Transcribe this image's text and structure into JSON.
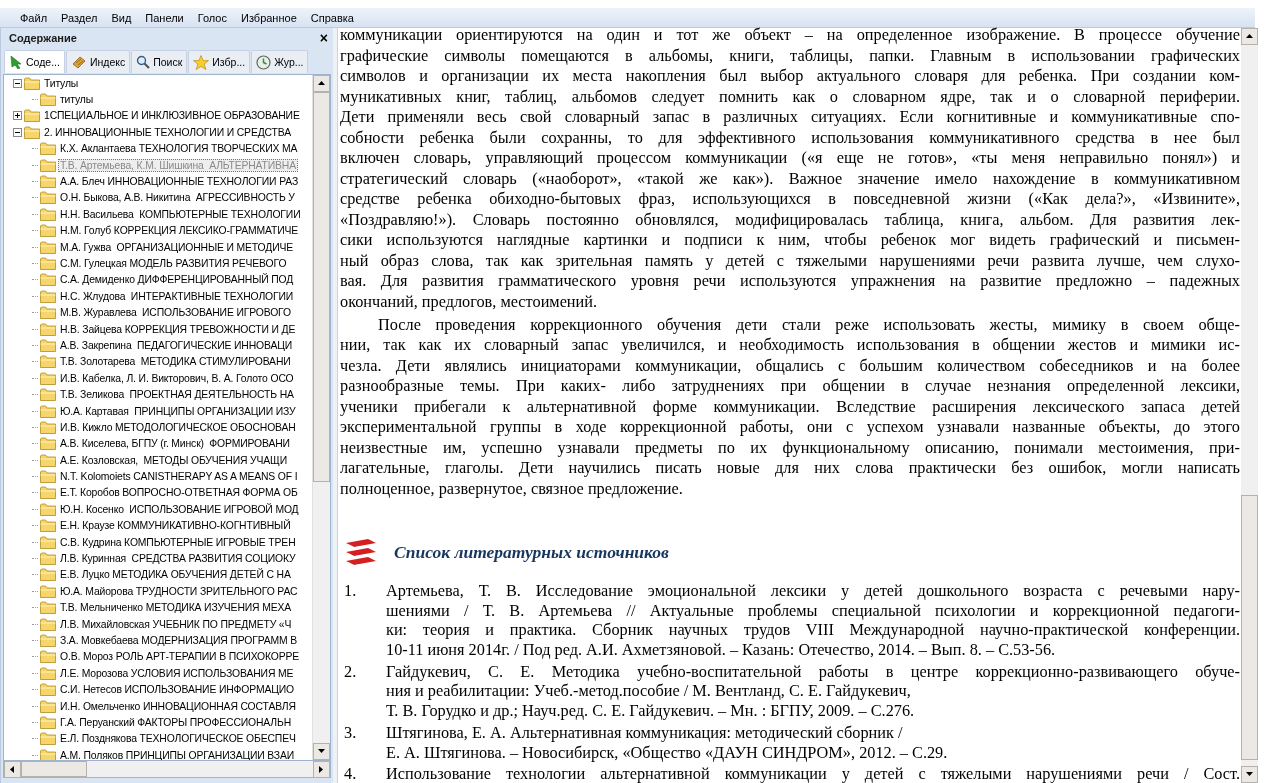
{
  "menu": [
    "Файл",
    "Раздел",
    "Вид",
    "Панели",
    "Голос",
    "Избранное",
    "Справка"
  ],
  "contents_panel": {
    "title": "Содержание",
    "close": "×",
    "tabs": [
      {
        "label": "Соде...",
        "selected": true
      },
      {
        "label": "Индекс",
        "selected": false
      },
      {
        "label": "Поиск",
        "selected": false
      },
      {
        "label": "Избр...",
        "selected": false
      },
      {
        "label": "Жур...",
        "selected": false
      }
    ],
    "tree": [
      {
        "label": "Титулы",
        "expanded": true,
        "selected": false,
        "children": [
          {
            "label": "титулы",
            "selected": false
          }
        ]
      },
      {
        "label": "1СПЕЦИАЛЬНОЕ И ИНКЛЮЗИВНОЕ ОБРАЗОВАНИЕ",
        "expanded": false,
        "selected": false
      },
      {
        "label": "2. ИННОВАЦИОННЫЕ ТЕХНОЛОГИИ И СРЕДСТВА",
        "expanded": true,
        "selected": false,
        "children": [
          {
            "label": "К.Х. Аклантаева ТЕХНОЛОГИЯ ТВОРЧЕСКИХ МА",
            "selected": false
          },
          {
            "label": "Т.В. Артемьева, К.М. Шишкина  АЛЬТЕРНАТИВНА",
            "selected": true
          },
          {
            "label": "А.А. Блеч ИННОВАЦИОННЫЕ ТЕХНОЛОГИИ РАЗ",
            "selected": false
          },
          {
            "label": "О.Н. Быкова, А.В. Никитина  АГРЕССИВНОСТЬ У",
            "selected": false
          },
          {
            "label": "Н.Н. Васильева  КОМПЬЮТЕРНЫЕ ТЕХНОЛОГИИ",
            "selected": false
          },
          {
            "label": "Н.М. Голуб КОРРЕКЦИЯ ЛЕКСИКО-ГРАММАТИЧЕ",
            "selected": false
          },
          {
            "label": "М.А. Гужва  ОРГАНИЗАЦИОННЫЕ И МЕТОДИЧЕ",
            "selected": false
          },
          {
            "label": "С.М. Гулецкая МОДЕЛЬ РАЗВИТИЯ РЕЧЕВОГО",
            "selected": false
          },
          {
            "label": "С.А. Демиденко ДИФФЕРЕНЦИРОВАННЫЙ ПОД",
            "selected": false
          },
          {
            "label": "Н.С. Жлудова  ИНТЕРАКТИВНЫЕ ТЕХНОЛОГИИ",
            "selected": false
          },
          {
            "label": "М.В. Журавлева  ИСПОЛЬЗОВАНИЕ ИГРОВОГО",
            "selected": false
          },
          {
            "label": "Н.В. Зайцева КОРРЕКЦИЯ ТРЕВОЖНОСТИ И ДЕ",
            "selected": false
          },
          {
            "label": "А.В. Закрепина  ПЕДАГОГИЧЕСКИЕ ИННОВАЦИ",
            "selected": false
          },
          {
            "label": "Т.В. Золотарева  МЕТОДИКА СТИМУЛИРОВАНИ",
            "selected": false
          },
          {
            "label": "И.В. Кабелка, Л. И. Викторович, В. А. Голото ОСО",
            "selected": false
          },
          {
            "label": "Т.В. Зеликова  ПРОЕКТНАЯ ДЕЯТЕЛЬНОСТЬ НА",
            "selected": false
          },
          {
            "label": "Ю.А. Картавая  ПРИНЦИПЫ ОРГАНИЗАЦИИ ИЗУ",
            "selected": false
          },
          {
            "label": "И.В. Кижло МЕТОДОЛОГИЧЕСКОЕ ОБОСНОВАН",
            "selected": false
          },
          {
            "label": "А.В. Киселева, БГПУ (г. Минск)  ФОРМИРОВАНИ",
            "selected": false
          },
          {
            "label": "А.Е. Козловская,  МЕТОДЫ ОБУЧЕНИЯ УЧАЩИ",
            "selected": false
          },
          {
            "label": "N.T. Kolomoiets CANISTHERAPY AS A MEANS OF I",
            "selected": false
          },
          {
            "label": "Е.Т. Коробов ВОПРОСНО-ОТВЕТНАЯ ФОРМА ОБ",
            "selected": false
          },
          {
            "label": "Ю.Н. Косенко  ИСПОЛЬЗОВАНИЕ ИГРОВОЙ МОД",
            "selected": false
          },
          {
            "label": "Е.Н. Краузе КОММУНИКАТИВНО-КОГНТИВНЫЙ",
            "selected": false
          },
          {
            "label": "С.В. Кудрина КОМПЬЮТЕРНЫЕ ИГРОВЫЕ ТРЕН",
            "selected": false
          },
          {
            "label": "Л.В. Куринная  СРЕДСТВА РАЗВИТИЯ СОЦИОКУ",
            "selected": false
          },
          {
            "label": "Е.В. Луцко МЕТОДИКА ОБУЧЕНИЯ ДЕТЕЙ С НА",
            "selected": false
          },
          {
            "label": "Ю.А. Майорова ТРУДНОСТИ ЗРИТЕЛЬНОГО РАС",
            "selected": false
          },
          {
            "label": "Т.В. Мельниченко МЕТОДИКА ИЗУЧЕНИЯ МЕХА",
            "selected": false
          },
          {
            "label": "Л.В. Михайловская УЧЕБНИК ПО ПРЕДМЕТУ «Ч",
            "selected": false
          },
          {
            "label": "З.А. Мовкебаева МОДЕРНИЗАЦИЯ ПРОГРАММ В",
            "selected": false
          },
          {
            "label": "О.В. Мороз РОЛЬ АРТ-ТЕРАПИИ В ПСИХОКОРРЕ",
            "selected": false
          },
          {
            "label": "Л.Е. Морозова УСЛОВИЯ ИСПОЛЬЗОВАНИЯ МЕ",
            "selected": false
          },
          {
            "label": "С.И. Нетесов ИСПОЛЬЗОВАНИЕ ИНФОРМАЦИО",
            "selected": false
          },
          {
            "label": "И.Н. Омельченко ИННОВАЦИОННАЯ СОСТАВЛЯ",
            "selected": false
          },
          {
            "label": "Г.А. Перуанский ФАКТОРЫ ПРОФЕССИОНАЛЬН",
            "selected": false
          },
          {
            "label": "Е.Л. Позднякова ТЕХНОЛОГИЧЕСКОЕ ОБЕСПЕЧ",
            "selected": false
          },
          {
            "label": "А.М. Поляков ПРИНЦИПЫ ОРГАНИЗАЦИИ ВЗАИ",
            "selected": false
          }
        ]
      }
    ]
  },
  "document": {
    "paragraphs": [
      {
        "indent": false,
        "lines": [
          {
            "text": "коммуникации ориентируются на один и тот же объект – на определенное изображение. В процессе обучение",
            "justified": true
          },
          {
            "text": "графические символы помещаются в альбомы, книги, таблицы, папки. Главным в использовании графических",
            "justified": true
          },
          {
            "text": "символов и организации их места накопления был выбор актуального словаря для ребенка. При создании ком-",
            "justified": true
          },
          {
            "text": "муникативных книг, таблиц, альбомов следует помнить как о словарном ядре, так и о словарной периферии.",
            "justified": true
          },
          {
            "text": "Дети применяли весь свой словарный запас в различных ситуациях. Если когнитивные и коммуникативные спо-",
            "justified": true
          },
          {
            "text": "собности ребенка были сохранны, то для эффективного использования коммуникативного средства в нее был",
            "justified": true
          },
          {
            "text": "включен словарь, управляющий процессом коммуникации («я еще не готов», «ты меня неправильно понял») и",
            "justified": true
          },
          {
            "text": "стратегический словарь («наоборот», «такой же как»). Важное значение имело нахождение в коммуникативном",
            "justified": true
          },
          {
            "text": "средстве ребенка обиходно-бытовых фраз, использующихся в повседневной жизни («Как дела?», «Извините»,",
            "justified": true
          },
          {
            "text": "«Поздравляю!»). Словарь постоянно обновлялся, модифицировалась таблица, книга, альбом. Для развития лек-",
            "justified": true
          },
          {
            "text": "сики используются наглядные картинки и подписи к ним, чтобы ребенок мог видеть графический и письмен-",
            "justified": true
          },
          {
            "text": "ный образ слова, так как зрительная память у детей с тяжелыми нарушениями речи развита лучше, чем слухо-",
            "justified": true
          },
          {
            "text": "вая. Для развития грамматического уровня речи используются упражнения на развитие предложно – падежных",
            "justified": true
          },
          {
            "text": "окончаний, предлогов, местоимений.",
            "justified": false
          }
        ]
      },
      {
        "indent": true,
        "lines": [
          {
            "text": "После проведения коррекционного обучения дети стали реже использовать жесты, мимику в своем обще-",
            "justified": true
          },
          {
            "text": "нии, так как их словарный запас увеличился, и необходимость использования в общении жестов и мимики ис-",
            "justified": true
          },
          {
            "text": "чезла. Дети являлись инициаторами коммуникации, общались с большим количеством собеседников и на более",
            "justified": true
          },
          {
            "text": "разнообразные темы. При каких- либо затруднениях при общении в случае незнания определенной лексики,",
            "justified": true
          },
          {
            "text": "ученики прибегали к альтернативной форме коммуникации. Вследствие расширения лексического запаса детей",
            "justified": true
          },
          {
            "text": "экспериментальной группы в ходе коррекционной работы, они с успехом узнавали названные объекты, до этого",
            "justified": true
          },
          {
            "text": "неизвестные им, успешно узнавали предметы по их функциональному описанию, понимали местоимения, при-",
            "justified": true
          },
          {
            "text": "лагательные, глаголы. Дети научились писать новые для них слова практически без ошибок, могли написать",
            "justified": true
          },
          {
            "text": "полноценное, развернутое, связное предложение.",
            "justified": false
          }
        ]
      }
    ],
    "heading": "Список литературных источников",
    "references": [
      {
        "number": "1.",
        "lines": [
          {
            "text": "Артемьева, Т. В. Исследование эмоциональной лексики у детей дошкольного возраста с речевыми нару-",
            "justified": true
          },
          {
            "text": "шениями / Т. В. Артемьева // Актуальные проблемы специальной психологии и коррекционной педагоги-",
            "justified": true
          },
          {
            "text": "ки: теория и практика. Сборник научных трудов VIII Международной научно-практической конференции.",
            "justified": true
          },
          {
            "text": "10-11 июня 2014г. / Под ред. А.И. Ахметзяновой. – Казань: Отечество, 2014. – Вып. 8. – С.53-56.",
            "justified": false
          }
        ]
      },
      {
        "number": "2.",
        "lines": [
          {
            "text": "Гайдукевич, С. Е. Методика учебно-воспитательной работы в центре коррекционно-развивающего обуче-",
            "justified": true
          },
          {
            "text": "ния и реабилитации: Учеб.-метод.пособие / М. Вентланд, С. Е. Гайдукевич,",
            "justified": false
          },
          {
            "text": "Т. В. Горудко и др.; Науч.ред. С. Е. Гайдукевич. – Мн. : БГПУ, 2009. – С.276.",
            "justified": false
          }
        ]
      },
      {
        "number": "3.",
        "lines": [
          {
            "text": "Штягинова, Е. А. Альтернативная коммуникация: методический сборник /",
            "justified": false
          },
          {
            "text": "Е. А. Штягинова. – Новосибирск, «Общество «ДАУН СИНДРОМ», 2012. – С.29.",
            "justified": false
          }
        ]
      },
      {
        "number": "4.",
        "lines": [
          {
            "text": "Использование технологии альтернативной коммуникации у детей с тяжелыми нарушениями речи / Сост.",
            "justified": true
          }
        ]
      }
    ]
  }
}
